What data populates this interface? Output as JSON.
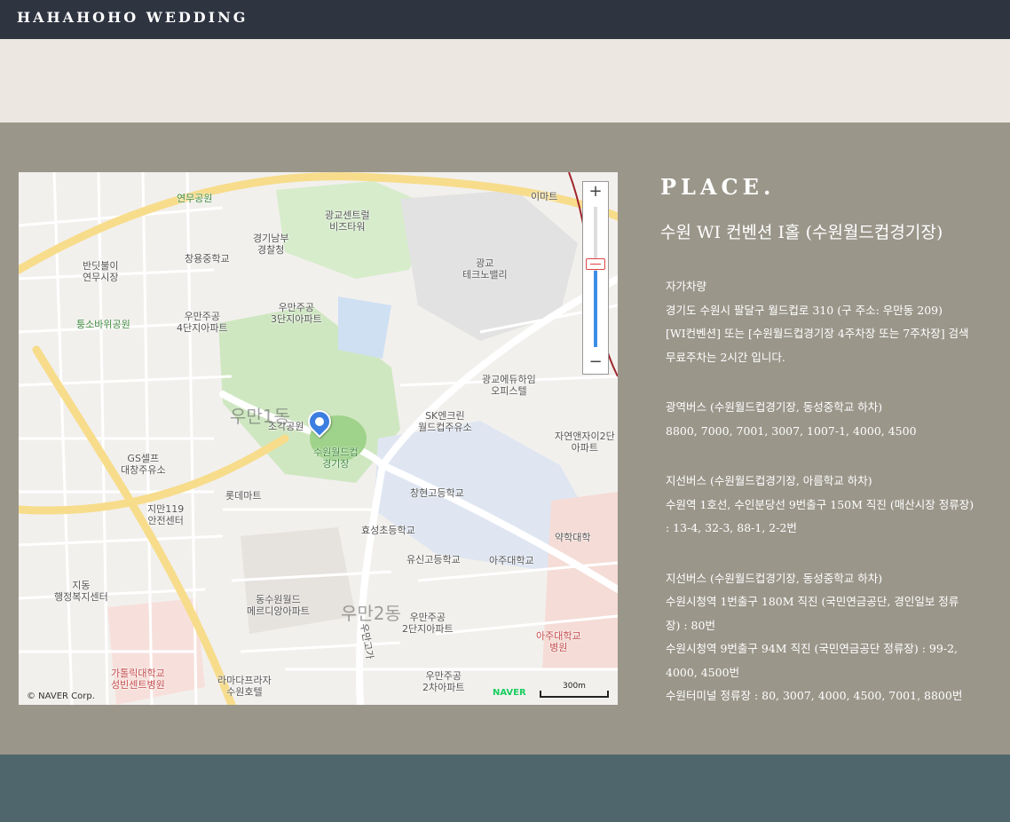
{
  "header": {
    "brand": "HAHAHOHO WEDDING"
  },
  "place": {
    "heading": "PLACE.",
    "venue": "수원 WI 컨벤션 I홀 (수원월드컵경기장)",
    "groups": [
      {
        "lines": [
          "자가차량",
          "경기도 수원시 팔달구 월드컵로 310 (구 주소: 우만동 209)",
          "[WI컨벤션] 또는 [수원월드컵경기장 4주차장 또는 7주차장] 검색",
          "무료주차는 2시간 입니다."
        ]
      },
      {
        "lines": [
          "광역버스 (수원월드컵경기장, 동성중학교 하차)",
          "8800, 7000, 7001, 3007, 1007-1, 4000, 4500"
        ]
      },
      {
        "lines": [
          "지선버스 (수원월드컵경기장, 아름학교 하차)",
          "수원역 1호선, 수인분당선 9번출구 150M 직진 (매산시장 정류장)",
          ": 13-4, 32-3, 88-1, 2-2번"
        ]
      },
      {
        "lines": [
          "지선버스 (수원월드컵경기장, 동성중학교 하차)",
          "수원시청역 1번출구 180M 직진 (국민연금공단, 경인일보 정류",
          "장) : 80번",
          "수원시청역 9번출구 94M 직진 (국민연금공단 정류장) : 99-2,",
          "4000, 4500번",
          "수원터미널 정류장 : 80, 3007, 4000, 4500, 7001, 8800번"
        ]
      }
    ]
  },
  "map": {
    "labels": {
      "l1": "연무공원",
      "l2": "광교센트럴\n비즈타워",
      "l3": "이마트",
      "l4": "경기남부\n경찰청",
      "l5": "창용중학교",
      "l6": "반딧불이\n연무시장",
      "l7": "광교\n테크노밸리",
      "l8": "우만주공\n3단지아파트",
      "l9": "우만주공\n4단지아파트",
      "l10": "퉁소바위공원",
      "l11": "광교에듀하임\n오피스텔",
      "l12": "조각공원",
      "l13": "수원월드컵\n경기장",
      "l14": "SK엔크린\n월드컵주유소",
      "l15": "자연앤자이2단\n아파트",
      "l16": "GS셀프\n대창주유소",
      "l17": "롯데마트",
      "l18": "창현고등학교",
      "l19": "지만119\n안전센터",
      "l20": "효성초등학교",
      "l21": "유신고등학교",
      "l22": "아주대학교",
      "l23": "약학대학",
      "l24": "지동\n행정복지센터",
      "l25": "동수원월드\n메르디앙아파트",
      "l26": "우만주공\n2단지아파트",
      "l27": "아주대학교\n병원",
      "l28": "가톨릭대학교\n성빈센트병원",
      "l29": "라마다프라자\n수원호텔",
      "l30": "우만주공\n2차아파트",
      "l31": "우만1동",
      "l32": "우만2동",
      "l33": "우만고가"
    },
    "copyright": "© NAVER Corp.",
    "logo": "NAVER",
    "scale": "300m",
    "zoom_in": "+",
    "zoom_out": "−"
  },
  "colors": {
    "topbar": "#2e3440",
    "cream": "#ece7e0",
    "section": "#9a968a",
    "footer": "#4f676c",
    "pin": "#3b7de0"
  }
}
